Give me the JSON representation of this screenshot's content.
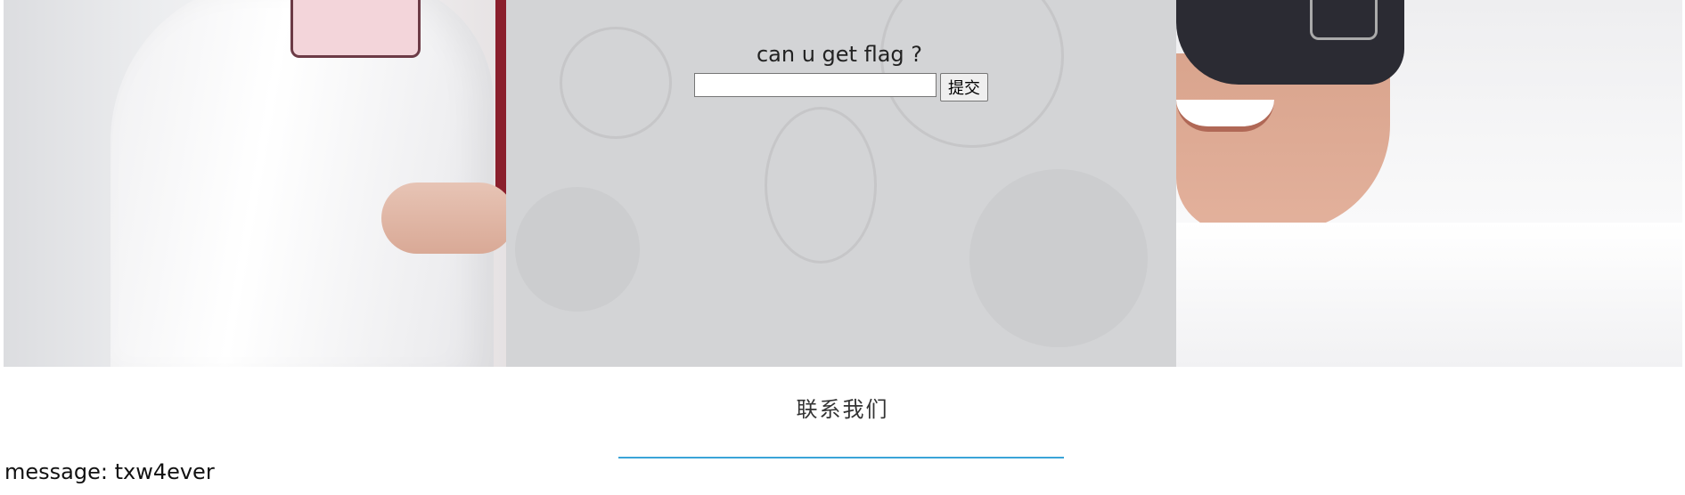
{
  "banner": {
    "question": "can u get flag ?",
    "input_value": "",
    "input_placeholder": "",
    "submit_label": "提交"
  },
  "contact": {
    "title": "联系我们"
  },
  "message": {
    "text": "message: txw4ever"
  },
  "colors": {
    "center_panel": "#d3d4d6",
    "divider_accent": "#3aa4d8",
    "lanyard": "#8a1f2c"
  },
  "icons": [
    "headset-image",
    "doctor-image"
  ]
}
